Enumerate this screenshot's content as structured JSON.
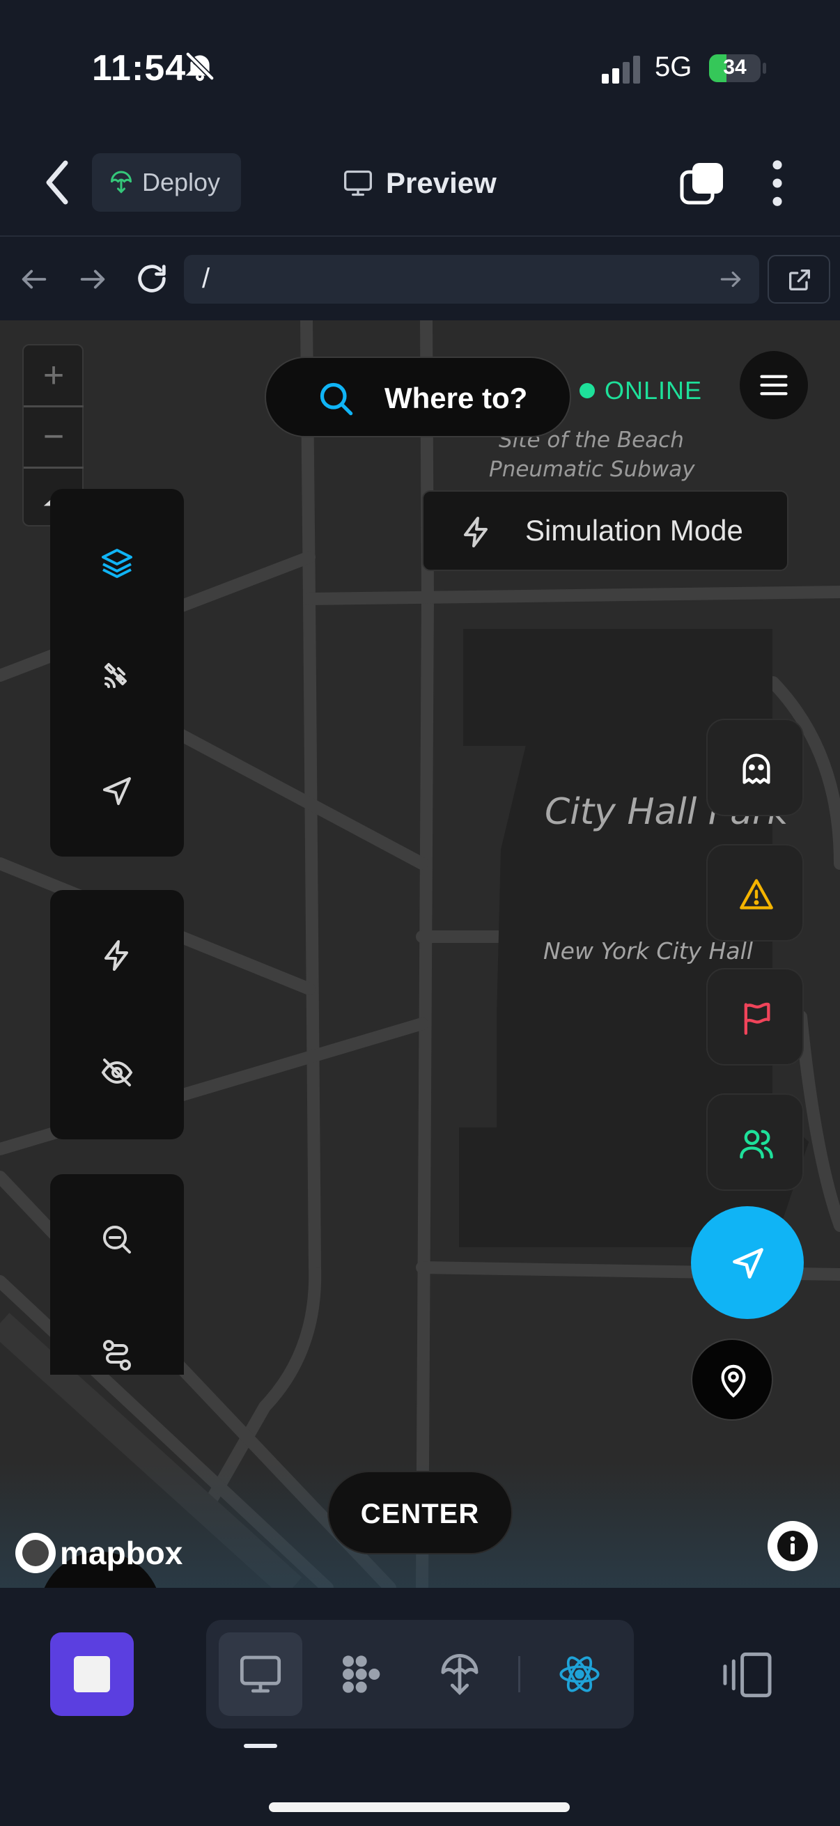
{
  "status_bar": {
    "time": "11:54",
    "network": "5G",
    "battery_percent": 34,
    "battery_label": "34"
  },
  "header": {
    "deploy_label": "Deploy",
    "title": "Preview"
  },
  "browser": {
    "url": "/"
  },
  "map": {
    "search_placeholder": "Where to?",
    "status_label": "ONLINE",
    "status_color": "#1ee09a",
    "simulation_label": "Simulation Mode",
    "labels": {
      "subway_line1": "Site of the Beach",
      "subway_line2": "Pneumatic Subway",
      "park": "City Hall Park",
      "hall": "New York City Hall"
    },
    "center_label": "CENTER",
    "attribution": "mapbox",
    "zoom_in": "+",
    "zoom_out": "−",
    "accent_color": "#10b4f5"
  },
  "left_tools": {
    "panel1": [
      "layers-icon",
      "satellite-icon",
      "navigation-arrow-icon"
    ],
    "panel2": [
      "lightning-icon",
      "eye-off-icon"
    ],
    "panel3": [
      "zoom-out-icon",
      "route-icon"
    ]
  },
  "right_tools": [
    "ghost-icon",
    "warning-icon",
    "flag-icon",
    "users-icon"
  ],
  "bottom_bar": {
    "tools": [
      "monitor-icon",
      "apps-icon",
      "deploy-icon",
      "react-icon"
    ],
    "stop_color": "#5b3fe0"
  }
}
